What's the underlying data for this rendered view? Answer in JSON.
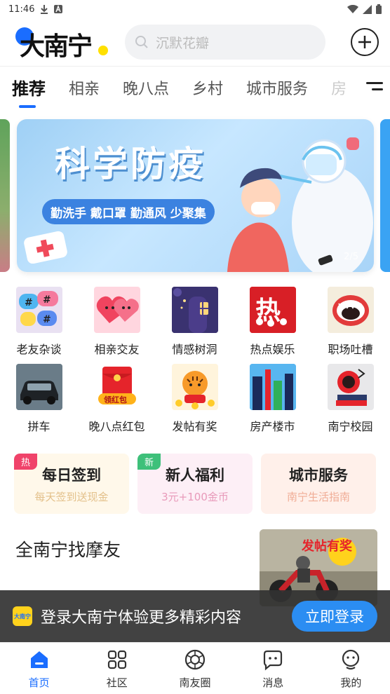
{
  "status": {
    "time": "11:46"
  },
  "header": {
    "logo_text": "大南宁",
    "search_placeholder": "沉默花瓣"
  },
  "tabs": [
    {
      "label": "推荐",
      "active": true
    },
    {
      "label": "相亲"
    },
    {
      "label": "晚八点"
    },
    {
      "label": "乡村"
    },
    {
      "label": "城市服务"
    },
    {
      "label": "房"
    }
  ],
  "banner": {
    "title": "科学防疫",
    "subtitle": "勤洗手 戴口罩 勤通风 少聚集",
    "indicator": "2/5"
  },
  "grid": [
    {
      "label": "老友杂谈",
      "icon": "chat-bubbles-icon",
      "color": "#e9e1f2"
    },
    {
      "label": "相亲交友",
      "icon": "hearts-icon",
      "color": "#ffd6df"
    },
    {
      "label": "情感树洞",
      "icon": "tree-hollow-icon",
      "color": "#2a2558"
    },
    {
      "label": "热点娱乐",
      "icon": "hot-news-icon",
      "color": "#e8262b"
    },
    {
      "label": "职场吐槽",
      "icon": "shouting-mouth-icon",
      "color": "#f4eddd"
    },
    {
      "label": "拼车",
      "icon": "car-icon",
      "color": "#5b6e7a"
    },
    {
      "label": "晚八点红包",
      "icon": "red-envelope-icon",
      "color": "#ffffff"
    },
    {
      "label": "发帖有奖",
      "icon": "tiger-reward-icon",
      "color": "#fff4dc"
    },
    {
      "label": "房产楼市",
      "icon": "buildings-icon",
      "color": "#3aa0e8"
    },
    {
      "label": "南宁校园",
      "icon": "campus-books-icon",
      "color": "#e8e8ea"
    }
  ],
  "cards": [
    {
      "badge": "热",
      "title": "每日签到",
      "subtitle": "每天签到送现金",
      "bg": "#fff8ea",
      "badge_color": "#f0436a",
      "sub_color": "#e3c08a"
    },
    {
      "badge": "新",
      "title": "新人福利",
      "subtitle": "3元+100金币",
      "bg": "#fdeff6",
      "badge_color": "#3ec07a",
      "sub_color": "#e89aba"
    },
    {
      "badge": "",
      "title": "城市服务",
      "subtitle": "南宁生活指南",
      "bg": "#fff0ea",
      "badge_color": "",
      "sub_color": "#f0ad96"
    }
  ],
  "feed": {
    "title": "全南宁找摩友",
    "thumb_caption": "发帖有奖"
  },
  "login_bar": {
    "logo": "大南宁",
    "text": "登录大南宁体验更多精彩内容",
    "button": "立即登录"
  },
  "bottom_nav": [
    {
      "label": "首页",
      "icon": "home-icon",
      "active": true
    },
    {
      "label": "社区",
      "icon": "grid-icon"
    },
    {
      "label": "南友圈",
      "icon": "aperture-icon"
    },
    {
      "label": "消息",
      "icon": "message-icon"
    },
    {
      "label": "我的",
      "icon": "profile-icon"
    }
  ]
}
